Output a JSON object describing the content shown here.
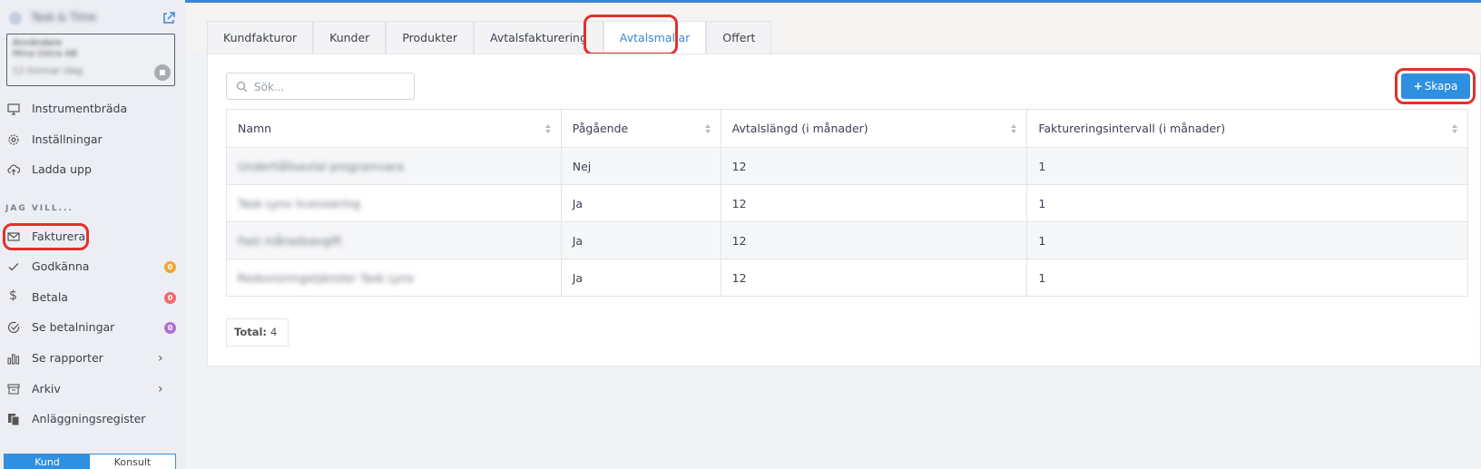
{
  "sidebar": {
    "org_name": "Task & Time",
    "user": {
      "line1": "Användare",
      "line2": "Mina Ostra AB",
      "line3": "12 timmar idag"
    },
    "items": [
      {
        "label": "Instrumentbräda",
        "icon": "monitor-icon"
      },
      {
        "label": "Inställningar",
        "icon": "gear-icon"
      },
      {
        "label": "Ladda upp",
        "icon": "cloud-upload-icon"
      }
    ],
    "section_label": "JAG VILL...",
    "actions": [
      {
        "label": "Fakturera",
        "icon": "mail-icon"
      },
      {
        "label": "Godkänna",
        "icon": "check-icon",
        "badge": "0",
        "badge_color": "#f0a63a"
      },
      {
        "label": "Betala",
        "icon": "dollar-icon",
        "badge": "0",
        "badge_color": "#ef6a6a"
      },
      {
        "label": "Se betalningar",
        "icon": "check-circle-icon",
        "badge": "0",
        "badge_color": "#b06fd0"
      },
      {
        "label": "Se rapporter",
        "icon": "bar-chart-icon"
      },
      {
        "label": "Arkiv",
        "icon": "archive-icon"
      },
      {
        "label": "Anläggningsregister",
        "icon": "documents-icon"
      }
    ],
    "toggle": {
      "active": "Kund",
      "inactive": "Konsult"
    }
  },
  "tabs": [
    "Kundfakturor",
    "Kunder",
    "Produkter",
    "Avtalsfakturering",
    "Avtalsmallar",
    "Offert"
  ],
  "active_tab": "Avtalsmallar",
  "search": {
    "placeholder": "Sök...",
    "value": ""
  },
  "create_button": "Skapa",
  "table": {
    "columns": [
      "Namn",
      "Pågående",
      "Avtalslängd (i månader)",
      "Faktureringsintervall (i månader)"
    ],
    "rows": [
      {
        "name": "Underhållsavtal programvara",
        "ongoing": "Nej",
        "length": "12",
        "interval": "1"
      },
      {
        "name": "Task Lynx licensiering",
        "ongoing": "Ja",
        "length": "12",
        "interval": "1"
      },
      {
        "name": "Fast månadsavgift",
        "ongoing": "Ja",
        "length": "12",
        "interval": "1"
      },
      {
        "name": "Redovisningstjänster Task Lynx",
        "ongoing": "Ja",
        "length": "12",
        "interval": "1"
      }
    ]
  },
  "total": {
    "label": "Total:",
    "value": "4"
  },
  "colors": {
    "accent": "#2f8fe0",
    "highlight": "#e0312c"
  }
}
